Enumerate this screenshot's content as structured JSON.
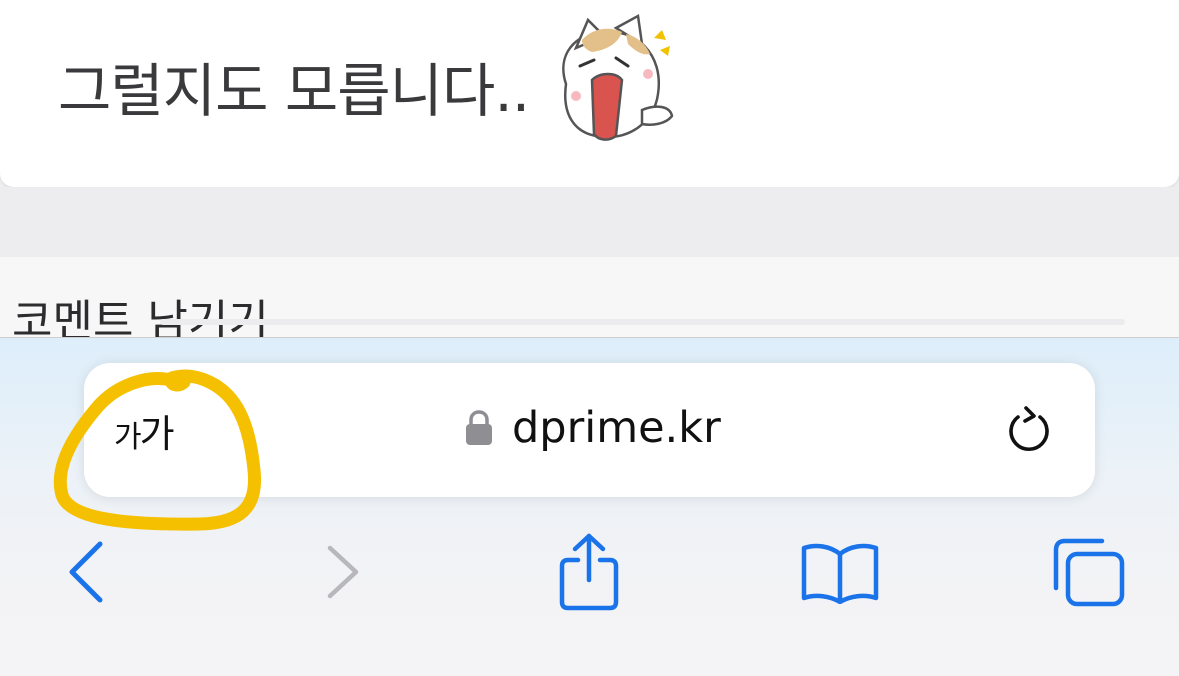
{
  "page": {
    "comment_text": "그럴지도 모릅니다..",
    "leave_comment_title": "코멘트 남기기"
  },
  "address_bar": {
    "reader_label_small": "가",
    "reader_label_large": "가",
    "url": "dprime.kr"
  },
  "icons": {
    "sticker": "surprised-cat-sticker",
    "lock": "lock-icon",
    "reload": "reload-icon",
    "back": "chevron-left-icon",
    "forward": "chevron-right-icon",
    "share": "share-icon",
    "bookmarks": "open-book-icon",
    "tabs": "tabs-icon"
  },
  "colors": {
    "accent": "#1a73e8",
    "disabled": "#b8b8bc",
    "highlight": "#f5c000"
  }
}
